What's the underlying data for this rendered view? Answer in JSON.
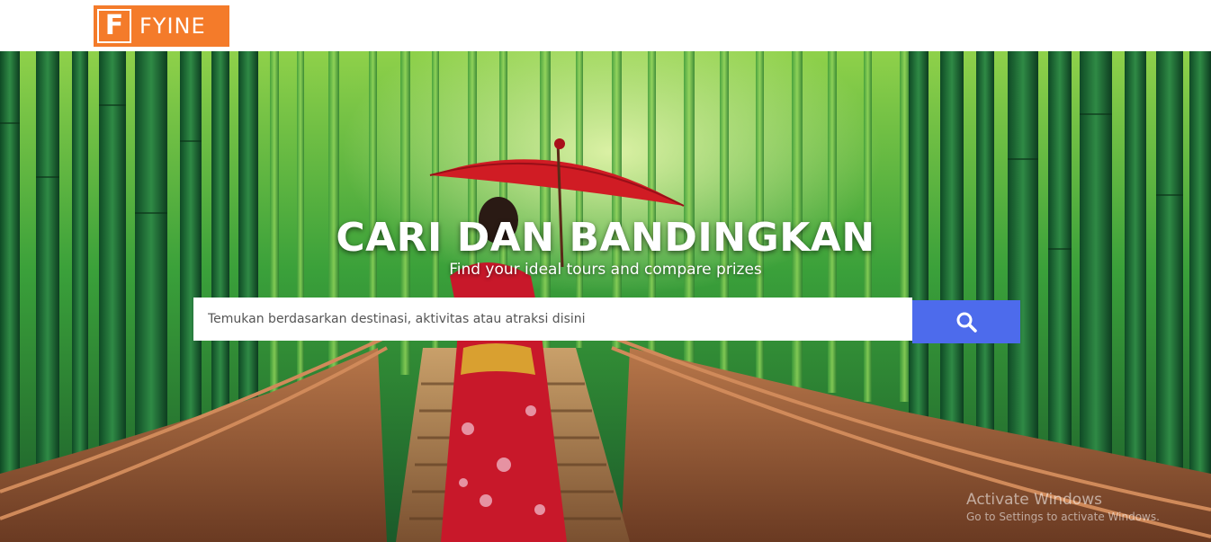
{
  "header": {
    "logo_mark": "F",
    "logo_text": "FYINE",
    "brand_color": "#f47b2a"
  },
  "hero": {
    "title": "CARI DAN BANDINGKAN",
    "subtitle": "Find your ideal tours and compare prizes",
    "background_image": "bamboo-forest-with-woman-in-kimono-holding-red-umbrella"
  },
  "search": {
    "placeholder": "Temukan berdasarkan destinasi, aktivitas atau atraksi disini",
    "value": "",
    "button_icon": "search-icon",
    "button_color": "#4d6bec"
  },
  "watermark": {
    "title": "Activate Windows",
    "subtitle": "Go to Settings to activate Windows."
  }
}
